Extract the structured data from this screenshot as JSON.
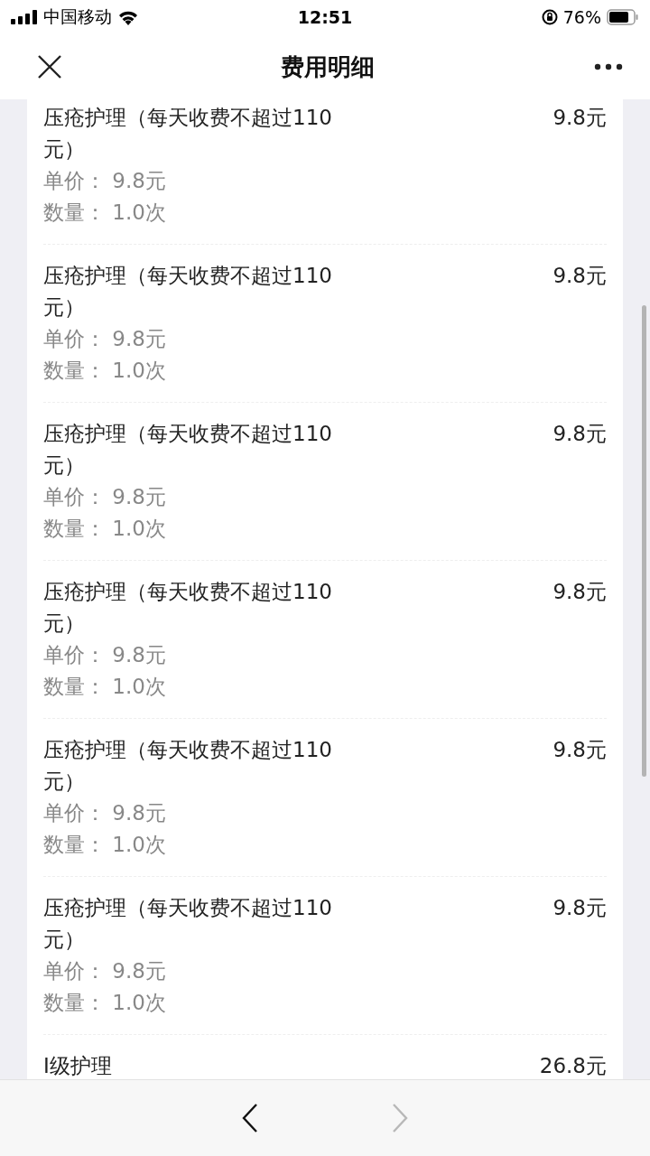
{
  "status_bar": {
    "carrier": "中国移动",
    "time": "12:51",
    "battery": "76%"
  },
  "nav": {
    "title": "费用明细"
  },
  "items": [
    {
      "title": "压疮护理（每天收费不超过110元）",
      "price": "9.8元",
      "unit_price": "单价：  9.8元",
      "quantity": "数量：  1.0次"
    },
    {
      "title": "压疮护理（每天收费不超过110元）",
      "price": "9.8元",
      "unit_price": "单价：  9.8元",
      "quantity": "数量：  1.0次"
    },
    {
      "title": "压疮护理（每天收费不超过110元）",
      "price": "9.8元",
      "unit_price": "单价：  9.8元",
      "quantity": "数量：  1.0次"
    },
    {
      "title": "压疮护理（每天收费不超过110元）",
      "price": "9.8元",
      "unit_price": "单价：  9.8元",
      "quantity": "数量：  1.0次"
    },
    {
      "title": "压疮护理（每天收费不超过110元）",
      "price": "9.8元",
      "unit_price": "单价：  9.8元",
      "quantity": "数量：  1.0次"
    },
    {
      "title": "压疮护理（每天收费不超过110元）",
      "price": "9.8元",
      "unit_price": "单价：  9.8元",
      "quantity": "数量：  1.0次"
    },
    {
      "title": "I级护理",
      "price": "26.8元"
    }
  ],
  "toolbar": {
    "back": {
      "disabled": false
    },
    "forward": {
      "disabled": true
    }
  }
}
